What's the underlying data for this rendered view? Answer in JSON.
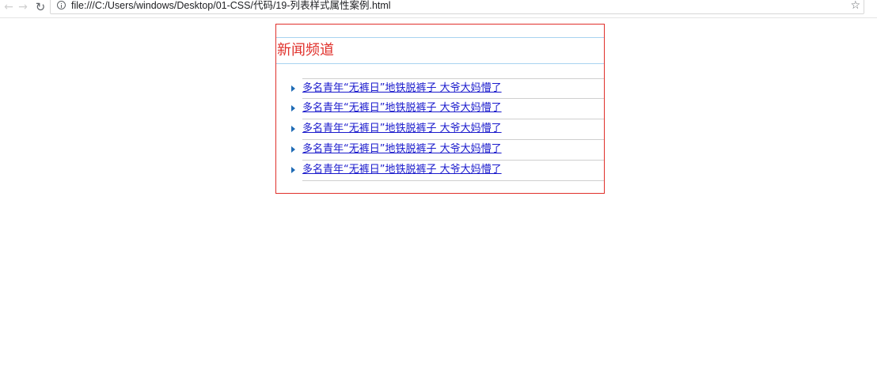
{
  "browser": {
    "url": "file:///C:/Users/windows/Desktop/01-CSS/代码/19-列表样式属性案例.html"
  },
  "news": {
    "title": "新闻频道",
    "items": [
      {
        "text": "多名青年“无裤日”地铁脱裤子 大爷大妈懵了"
      },
      {
        "text": "多名青年“无裤日”地铁脱裤子 大爷大妈懵了"
      },
      {
        "text": "多名青年“无裤日”地铁脱裤子 大爷大妈懵了"
      },
      {
        "text": "多名青年“无裤日”地铁脱裤子 大爷大妈懵了"
      },
      {
        "text": "多名青年“无裤日”地铁脱裤子 大爷大妈懵了"
      }
    ]
  },
  "colors": {
    "box_border": "#e0302b",
    "title_text": "#e0302b",
    "title_rule": "#a8d3f0",
    "link": "#1a1acc",
    "bullet": "#1f6bb5"
  },
  "icons": {
    "back": "arrow-left",
    "forward": "arrow-right",
    "reload": "reload",
    "info": "info-circle",
    "bookmark": "star-outline",
    "bullet": "triangle-right"
  }
}
